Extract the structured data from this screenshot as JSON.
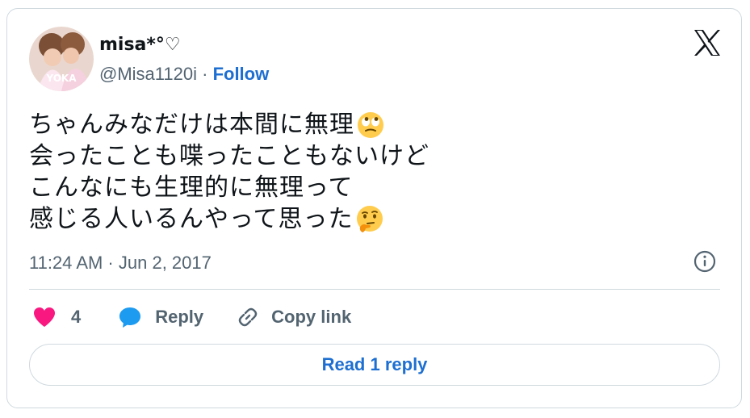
{
  "author": {
    "display_name": "misa*°♡",
    "handle": "@Misa1120i",
    "separator": "·",
    "follow_label": "Follow"
  },
  "tweet": {
    "lines": [
      "ちゃんみなだけは本間に無理",
      "会ったことも喋ったこともないけど",
      "こんなにも生理的に無理って",
      "感じる人いるんやって思った"
    ],
    "emojis": [
      "face-with-rolling-eyes",
      "thinking-face"
    ],
    "timestamp": "11:24 AM · Jun 2, 2017"
  },
  "actions": {
    "like_count": "4",
    "reply_label": "Reply",
    "copy_label": "Copy link",
    "read_replies_label": "Read 1 reply"
  },
  "colors": {
    "accent": "#1d6fd1",
    "like": "#f91880",
    "muted": "#536471",
    "border": "#cfd9de"
  }
}
